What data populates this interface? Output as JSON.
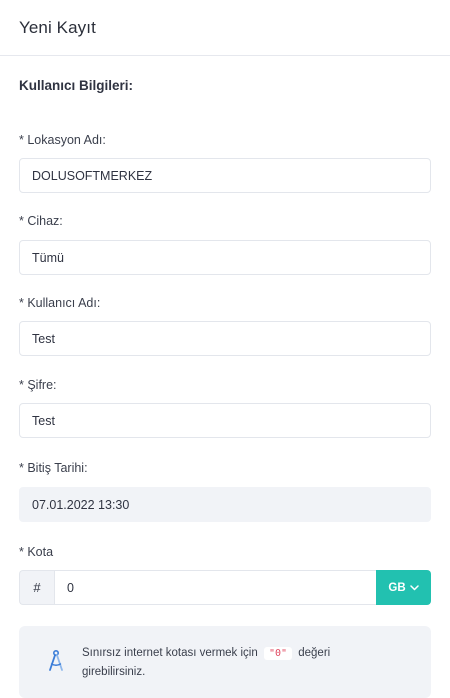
{
  "header": {
    "title": "Yeni Kayıt"
  },
  "section": {
    "title": "Kullanıcı Bilgileri:"
  },
  "fields": {
    "location": {
      "label": "* Lokasyon Adı:",
      "value": "DOLUSOFTMERKEZ"
    },
    "device": {
      "label": "* Cihaz:",
      "value": "Tümü"
    },
    "username": {
      "label": "* Kullanıcı Adı:",
      "value": "Test"
    },
    "password": {
      "label": "* Şifre:",
      "value": "Test"
    },
    "end_date": {
      "label": "* Bitiş Tarihi:",
      "value": "07.01.2022 13:30"
    },
    "quota": {
      "label": "* Kota",
      "prefix": "#",
      "value": "0",
      "unit": "GB"
    }
  },
  "info": {
    "text_before": "Sınırsız internet kotası vermek için",
    "code": "\"0\"",
    "text_after": "değeri girebilirsiniz."
  },
  "colors": {
    "accent": "#22c1b0",
    "code": "#e0475f",
    "info_icon": "#3b7dd8"
  }
}
